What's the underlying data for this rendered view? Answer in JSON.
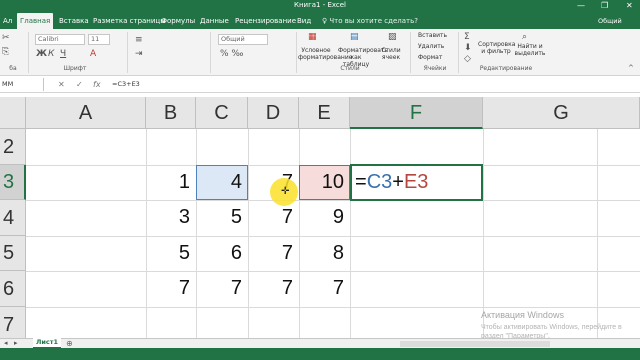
{
  "window": {
    "title": "Книга1 - Excel",
    "minimize": "—",
    "restore": "❐",
    "close": "✕"
  },
  "tabs": [
    {
      "label": "Ал"
    },
    {
      "label": "Главная"
    },
    {
      "label": "Вставка"
    },
    {
      "label": "Разметка страницы"
    },
    {
      "label": "Формулы"
    },
    {
      "label": "Данные"
    },
    {
      "label": "Рецензирование"
    },
    {
      "label": "Вид"
    }
  ],
  "tell_me": "♀ Что вы хотите сделать?",
  "share": "Общий доступ",
  "ribbon": {
    "font_name": "Calibri",
    "font_size": "11",
    "number_format": "Общий",
    "clipboard_label": "ба",
    "font_group_label": "Шрифт",
    "styles_group_label": "Стили",
    "cells_group_label": "Ячейки",
    "editing_group_label": "Редактирование",
    "cond_format": "Условное форматирование",
    "format_table": "Форматировать как таблицу",
    "cell_styles": "Стили ячеек",
    "insert": "Вставить",
    "delete": "Удалить",
    "format": "Формат",
    "sort_filter": "Сортировка и фильтр",
    "find_select": "Найти и выделить"
  },
  "formula_bar": {
    "name_box": "ММ",
    "cancel_icon": "✕",
    "enter_icon": "✓",
    "fx": "fx",
    "formula": "=C3+E3"
  },
  "grid": {
    "columns": [
      "A",
      "B",
      "C",
      "D",
      "E",
      "F",
      "G"
    ],
    "rows": [
      "2",
      "3",
      "4",
      "5",
      "6",
      "7"
    ],
    "active_column": "F",
    "active_row": "3",
    "values": {
      "B3": "1",
      "C3": "4",
      "D3": "7",
      "E3": "10",
      "B4": "3",
      "C4": "5",
      "D4": "7",
      "E4": "9",
      "B5": "5",
      "C5": "6",
      "D5": "7",
      "E5": "8",
      "B6": "7",
      "C6": "7",
      "D6": "7",
      "E6": "7"
    },
    "edit_cell": {
      "eq": "=",
      "ref1": "C3",
      "op": "+",
      "ref2": "E3"
    },
    "ref_colors": {
      "ref1": "#3a6fb0",
      "ref2": "#b5473f"
    }
  },
  "watermark": {
    "title": "Активация Windows",
    "line1": "Чтобы активировать Windows, перейдите в",
    "line2": "раздел \"Параметры\"."
  },
  "sheet": {
    "tab": "Лист1",
    "add": "⊕"
  }
}
